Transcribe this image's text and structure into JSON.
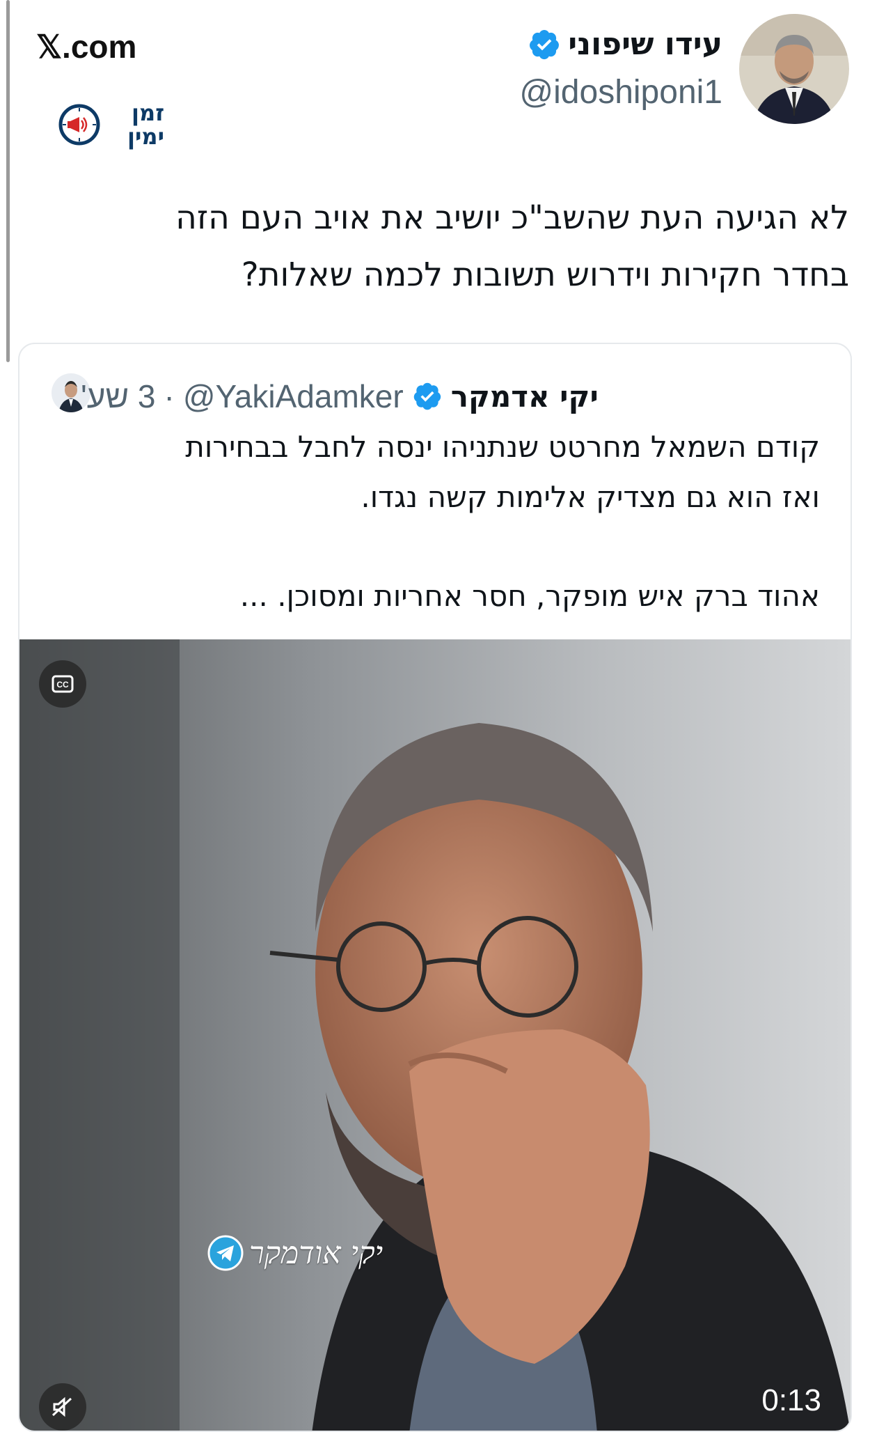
{
  "site": {
    "label": "𝕏.com"
  },
  "logo": {
    "line1": "זמן",
    "line2": "ימין"
  },
  "author": {
    "name": "עידו שיפוני",
    "handle": "@idoshiponi1",
    "verified": true
  },
  "tweet": {
    "text_line1": "לא הגיעה העת שהשב\"כ יושיב את אויב העם הזה",
    "text_line2": "בחדר חקירות וידרוש תשובות לכמה שאלות?"
  },
  "quote": {
    "name": "יקי אדמקר",
    "handle": "@YakiAdamker",
    "separator": "·",
    "time": "3 שע'",
    "line1": "קודם השמאל מחרטט שנתניהו ינסה לחבל בבחירות",
    "line2": "ואז הוא גם מצדיק אלימות קשה נגדו.",
    "line3": "אהוד ברק איש מופקר, חסר אחריות ומסוכן. ...",
    "video": {
      "duration": "0:13",
      "watermark": "יקי אודמקר",
      "cc_icon": "closed-captions-icon",
      "mute_icon": "muted-speaker-icon"
    }
  },
  "colors": {
    "verified": "#1d9bf0",
    "handle": "#536471",
    "logo_blue": "#0d3a66",
    "logo_red": "#d62828"
  }
}
